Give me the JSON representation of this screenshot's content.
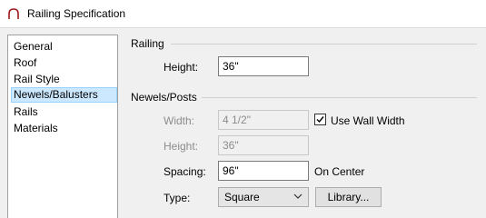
{
  "window": {
    "title": "Railing Specification"
  },
  "sidebar": {
    "items": [
      {
        "label": "General"
      },
      {
        "label": "Roof"
      },
      {
        "label": "Rail Style"
      },
      {
        "label": "Newels/Balusters"
      },
      {
        "label": "Rails"
      },
      {
        "label": "Materials"
      }
    ],
    "selected": "Newels/Balusters"
  },
  "railing": {
    "title": "Railing",
    "height_label": "Height:",
    "height_value": "36\""
  },
  "newels": {
    "title": "Newels/Posts",
    "width_label": "Width:",
    "width_value": "4 1/2\"",
    "use_wall_width_label": "Use Wall Width",
    "use_wall_width_checked": true,
    "height_label": "Height:",
    "height_value": "36\"",
    "spacing_label": "Spacing:",
    "spacing_value": "96\"",
    "on_center_label": "On Center",
    "type_label": "Type:",
    "type_value": "Square",
    "library_button": "Library..."
  }
}
